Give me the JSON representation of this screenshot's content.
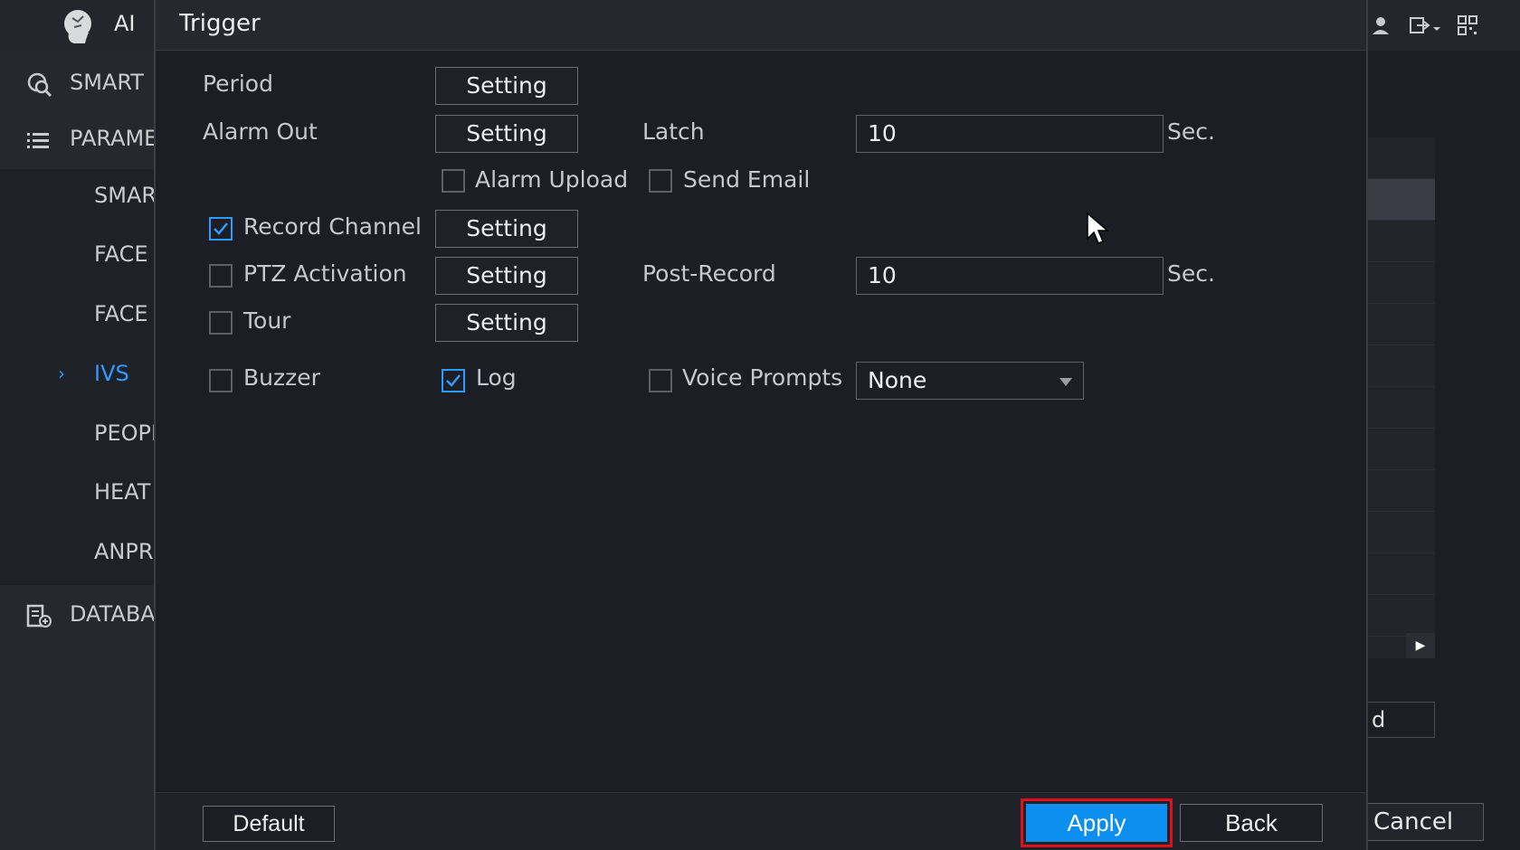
{
  "app": {
    "title": "AI"
  },
  "nav": {
    "items": [
      {
        "label": "SMART",
        "icon": "smart-search-icon"
      },
      {
        "label": "PARAMETERS",
        "icon": "list-icon"
      },
      {
        "label": "DATABASE",
        "icon": "database-icon"
      }
    ],
    "sub_items": [
      {
        "label": "SMART"
      },
      {
        "label": "FACE"
      },
      {
        "label": "FACE"
      },
      {
        "label": "IVS",
        "active": true
      },
      {
        "label": "PEOPLE"
      },
      {
        "label": "HEAT"
      },
      {
        "label": "ANPR"
      }
    ]
  },
  "topbar": {
    "icons": [
      "user-icon",
      "logout-icon",
      "qr-icon"
    ]
  },
  "dialog": {
    "title": "Trigger",
    "period": {
      "label": "Period",
      "button": "Setting"
    },
    "alarm_out": {
      "label": "Alarm Out",
      "button": "Setting"
    },
    "latch": {
      "label": "Latch",
      "value": "10",
      "unit": "Sec."
    },
    "alarm_upload": {
      "label": "Alarm Upload",
      "checked": false
    },
    "send_email": {
      "label": "Send Email",
      "checked": false
    },
    "record_channel": {
      "label": "Record Channel",
      "checked": true,
      "button": "Setting"
    },
    "ptz_activation": {
      "label": "PTZ Activation",
      "checked": false,
      "button": "Setting"
    },
    "post_record": {
      "label": "Post-Record",
      "value": "10",
      "unit": "Sec."
    },
    "tour": {
      "label": "Tour",
      "checked": false,
      "button": "Setting"
    },
    "buzzer": {
      "label": "Buzzer",
      "checked": false
    },
    "log": {
      "label": "Log",
      "checked": true
    },
    "voice_prompts": {
      "label": "Voice Prompts",
      "checked": false,
      "selected": "None"
    },
    "footer": {
      "default": "Default",
      "apply": "Apply",
      "back": "Back"
    }
  },
  "background": {
    "field_value": "d",
    "cancel": "Cancel"
  },
  "colors": {
    "accent": "#0d8ff0",
    "highlight": "#e0101a",
    "active_nav": "#2f9bff"
  }
}
